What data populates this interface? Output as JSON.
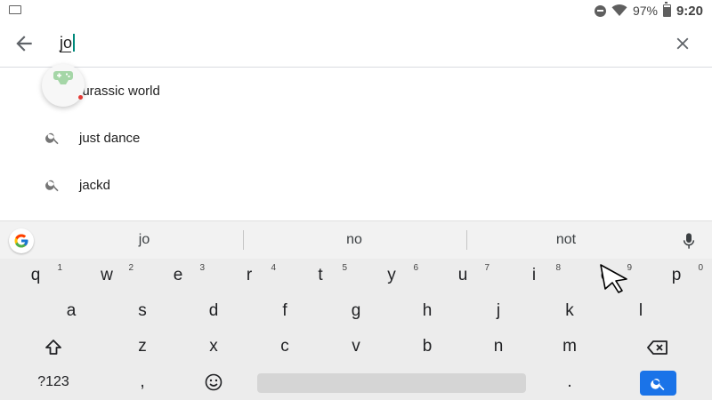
{
  "status_bar": {
    "battery_text": "97%",
    "time": "9:20"
  },
  "search": {
    "query": "jo"
  },
  "suggestions": [
    {
      "text": "jurassic world"
    },
    {
      "text": "just dance"
    },
    {
      "text": "jackd"
    }
  ],
  "keyboard": {
    "predictions": [
      "jo",
      "no",
      "not"
    ],
    "row1": [
      {
        "key": "q",
        "hint": "1"
      },
      {
        "key": "w",
        "hint": "2"
      },
      {
        "key": "e",
        "hint": "3"
      },
      {
        "key": "r",
        "hint": "4"
      },
      {
        "key": "t",
        "hint": "5"
      },
      {
        "key": "y",
        "hint": "6"
      },
      {
        "key": "u",
        "hint": "7"
      },
      {
        "key": "i",
        "hint": "8"
      },
      {
        "key": "o",
        "hint": "9"
      },
      {
        "key": "p",
        "hint": "0"
      }
    ],
    "row2": [
      "a",
      "s",
      "d",
      "f",
      "g",
      "h",
      "j",
      "k",
      "l"
    ],
    "row3": [
      "z",
      "x",
      "c",
      "v",
      "b",
      "n",
      "m"
    ],
    "symbols_label": "?123",
    "comma_label": ",",
    "period_label": "."
  },
  "colors": {
    "accent": "#1a73e8",
    "cursor": "#00897b"
  }
}
